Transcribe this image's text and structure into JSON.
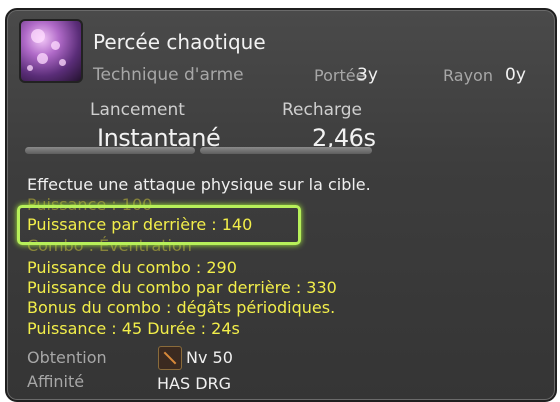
{
  "action": {
    "name": "Percée chaotique",
    "type": "Technique d'arme",
    "range_label": "Portée",
    "range_value": "3y",
    "radius_label": "Rayon",
    "radius_value": "0y",
    "cast_label": "Lancement",
    "cast_value": "Instantané",
    "recast_label": "Recharge",
    "recast_value": "2,46s"
  },
  "description": {
    "line1": "Effectue une attaque physique sur la cible.",
    "line2": "Puissance : 100",
    "line3": "Puissance par derrière : 140",
    "line4": "Combo : Éventration",
    "line5": "Puissance du combo : 290",
    "line6": "Puissance du combo par derrière : 330",
    "line7": "Bonus du combo : dégâts périodiques.",
    "line8": "Puissance : 45 Durée : 24s"
  },
  "meta": {
    "acquired_label": "Obtention",
    "acquired_value": "Nv 50",
    "affinity_label": "Affinité",
    "affinity_value": "HAS DRG"
  },
  "icons": {
    "action": "chaos-thrust-icon",
    "class": "lancer-icon"
  },
  "colors": {
    "highlight": "#b7f05a",
    "yellow_text": "#f2ee4a",
    "level_green": "#7fe36e"
  }
}
